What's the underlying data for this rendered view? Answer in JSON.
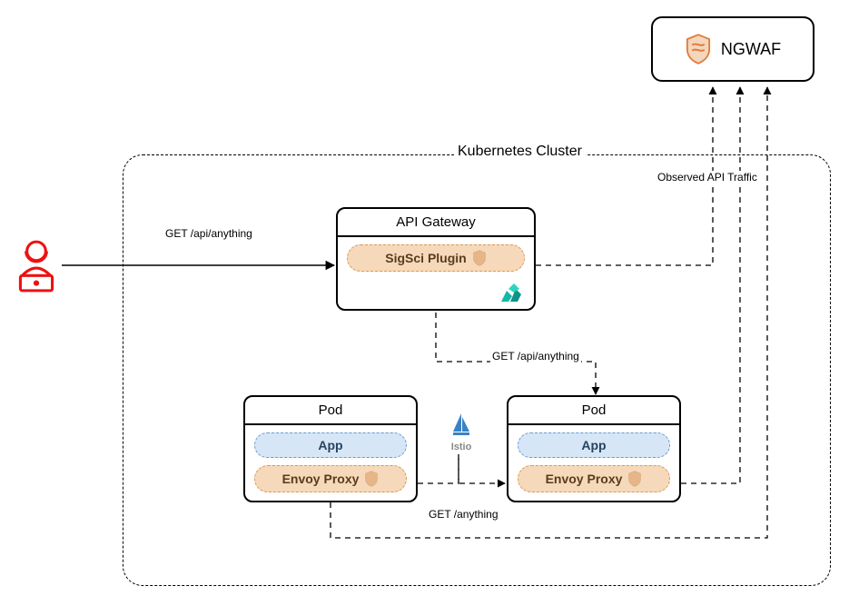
{
  "ngwaf": {
    "label": "NGWAF"
  },
  "cluster": {
    "label": "Kubernetes Cluster",
    "observed": "Observed API Traffic"
  },
  "gateway": {
    "title": "API Gateway",
    "plugin": "SigSci Plugin"
  },
  "pod_left": {
    "title": "Pod",
    "app": "App",
    "proxy": "Envoy Proxy"
  },
  "pod_right": {
    "title": "Pod",
    "app": "App",
    "proxy": "Envoy Proxy"
  },
  "istio": {
    "label": "Istio"
  },
  "edges": {
    "user_to_gateway": "GET /api/anything",
    "gateway_to_pod": "GET /api/anything",
    "pod_to_pod": "GET /anything"
  },
  "diagram": {
    "nodes": [
      "attacker",
      "api-gateway",
      "pod-left",
      "pod-right",
      "ngwaf",
      "istio"
    ],
    "flows": [
      {
        "from": "attacker",
        "to": "api-gateway",
        "label_key": "edges.user_to_gateway",
        "style": "solid"
      },
      {
        "from": "api-gateway.sigsci-plugin",
        "to": "ngwaf",
        "style": "dashed"
      },
      {
        "from": "api-gateway",
        "to": "pod-right",
        "label_key": "edges.gateway_to_pod",
        "style": "dashed"
      },
      {
        "from": "pod-left.envoy-proxy",
        "to": "pod-right.envoy-proxy",
        "via": "istio",
        "label_key": "edges.pod_to_pod",
        "style": "dashed"
      },
      {
        "from": "pod-left.envoy-proxy",
        "to": "ngwaf",
        "style": "dashed"
      },
      {
        "from": "pod-right.envoy-proxy",
        "to": "ngwaf",
        "style": "dashed"
      }
    ]
  }
}
